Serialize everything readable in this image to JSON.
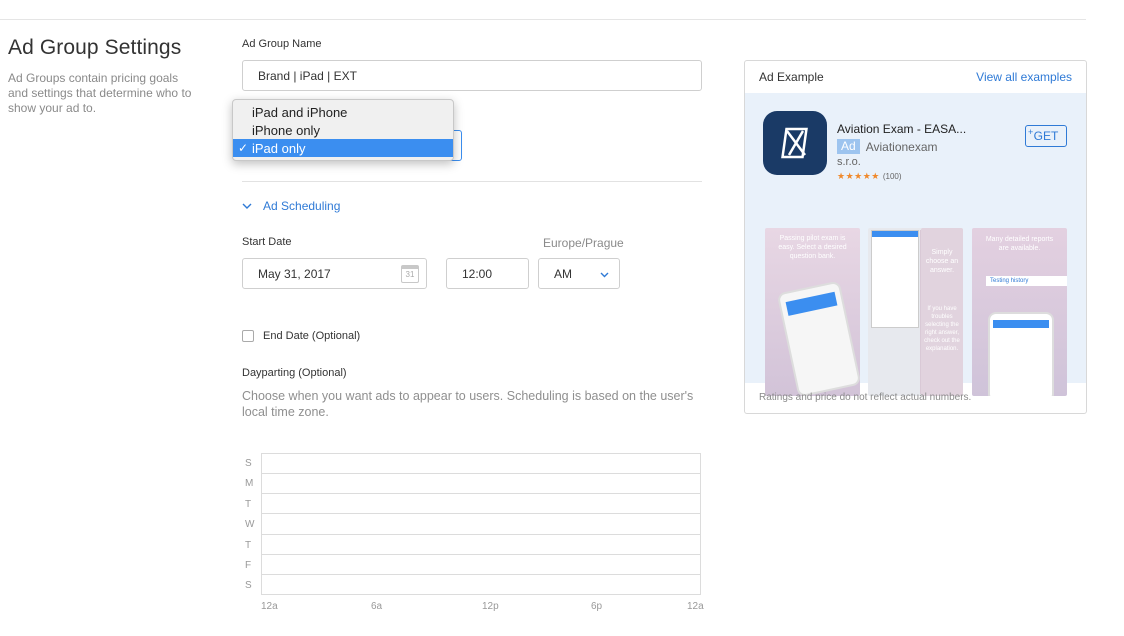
{
  "page": {
    "title": "Ad Group Settings",
    "description": "Ad Groups contain pricing goals and settings that determine who to show your ad to."
  },
  "ad_group_name": {
    "label": "Ad Group Name",
    "value": "Brand | iPad | EXT"
  },
  "devices_dropdown": {
    "options": [
      "iPad and iPhone",
      "iPhone only",
      "iPad only"
    ],
    "selected": "iPad only",
    "check": "✓"
  },
  "scheduling": {
    "section_label": "Ad Scheduling",
    "start_date_label": "Start Date",
    "timezone": "Europe/Prague",
    "date_value": "May 31, 2017",
    "calendar_day": "31",
    "time_value": "12:00",
    "ampm_value": "AM",
    "end_date_label": "End Date (Optional)",
    "end_date_checked": false
  },
  "dayparting": {
    "label": "Dayparting (Optional)",
    "help": "Choose when you want ads to appear to users. Scheduling is based on the user's local time zone.",
    "days": [
      "S",
      "M",
      "T",
      "W",
      "T",
      "F",
      "S"
    ],
    "hours": [
      "12a",
      "6a",
      "12p",
      "6p",
      "12a"
    ]
  },
  "ad_example": {
    "title": "Ad Example",
    "view_all": "View all examples",
    "app_name": "Aviation Exam - EASA...",
    "ad_badge": "Ad",
    "developer_1": "Aviationexam",
    "developer_2": "s.r.o.",
    "stars": "★★★★★",
    "rating_count": "(100)",
    "get_button": "GET",
    "plus": "+",
    "shot1_text": "Passing pilot exam is easy. Select a desired question bank.",
    "shot3_text": "Simply choose an answer.",
    "shot3_text2": "If you have troubles selecting the right answer, check out the explanation.",
    "shot4_text": "Many detailed reports are available.",
    "shot4_item": "Testing history",
    "footer": "Ratings and price do not reflect actual numbers.",
    "colors": {
      "icon_bg": "#1a3a66",
      "accent": "#2f7ad6",
      "star": "#f0892b"
    }
  }
}
